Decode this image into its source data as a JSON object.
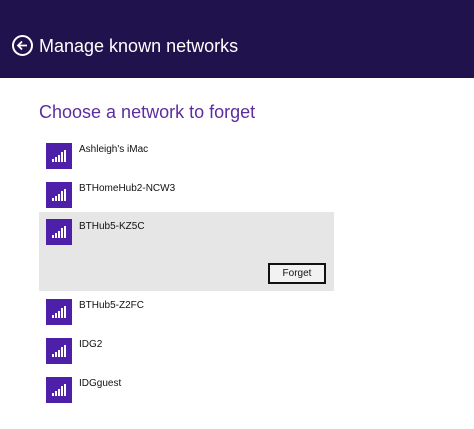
{
  "header": {
    "title": "Manage known networks",
    "back_icon": "arrow-left-circle-icon",
    "background": "#20124d"
  },
  "section_title": "Choose a network to forget",
  "accent_color": "#4e1fa8",
  "networks": [
    {
      "name": "Ashleigh's iMac",
      "icon": "wifi-signal-icon",
      "selected": false
    },
    {
      "name": "BTHomeHub2-NCW3",
      "icon": "wifi-signal-icon",
      "selected": false
    },
    {
      "name": "BTHub5-KZ5C",
      "icon": "wifi-signal-icon",
      "selected": true
    },
    {
      "name": "BTHub5-Z2FC",
      "icon": "wifi-signal-icon",
      "selected": false
    },
    {
      "name": "IDG2",
      "icon": "wifi-signal-icon",
      "selected": false
    },
    {
      "name": "IDGguest",
      "icon": "wifi-signal-icon",
      "selected": false
    }
  ],
  "forget_button_label": "Forget"
}
